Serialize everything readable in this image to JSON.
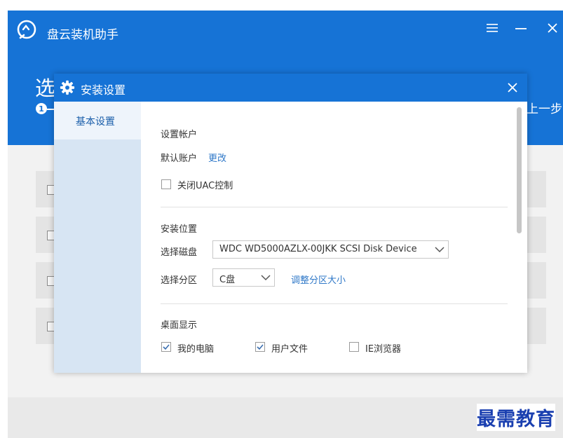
{
  "app": {
    "title": "盘云装机助手",
    "heading": "选",
    "step_number": "1",
    "prev_label": "上一步"
  },
  "dialog": {
    "title": "安装设置",
    "sidebar": {
      "items": [
        {
          "label": "基本设置",
          "active": true
        }
      ]
    },
    "account": {
      "section_title": "设置帐户",
      "default_label": "默认账户",
      "change_link": "更改",
      "uac": {
        "label": "关闭UAC控制",
        "checked": false
      }
    },
    "location": {
      "section_title": "安装位置",
      "disk_label": "选择磁盘",
      "disk_value": "WDC WD5000AZLX-00JKK SCSI Disk Device",
      "partition_label": "选择分区",
      "partition_value": "C盘",
      "resize_link": "调整分区大小"
    },
    "desktop": {
      "section_title": "桌面显示",
      "options": [
        {
          "label": "我的电脑",
          "checked": true
        },
        {
          "label": "用户文件",
          "checked": true
        },
        {
          "label": "IE浏览器",
          "checked": false
        }
      ]
    }
  },
  "watermark": "最需教育",
  "colors": {
    "accent": "#1673d6",
    "link": "#2f78c8",
    "sidebar": "#d7e5f3"
  }
}
